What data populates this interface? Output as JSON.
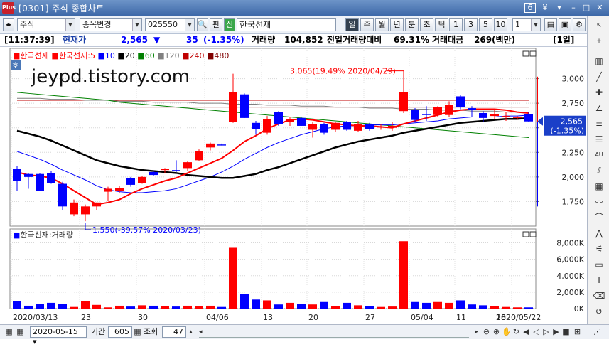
{
  "window": {
    "app_badge": "Plus",
    "title": "[0301] 주식 종합차트",
    "page_no": "6",
    "pin": "¥",
    "restore": "□",
    "close": "✕"
  },
  "toolbar": {
    "market": "주식",
    "mode": "종목변경",
    "code": "025550",
    "search_btn": "판",
    "new_badge": "신",
    "stock_name": "한국선재",
    "periods": [
      "일",
      "주",
      "월",
      "년",
      "분",
      "초",
      "틱"
    ],
    "selected_period": 0,
    "intervals": [
      "1",
      "3",
      "5",
      "10"
    ],
    "interval_value": "1"
  },
  "info": {
    "time": "[11:37:39]",
    "price_label": "현재가",
    "price": "2,565",
    "arrow": "▼",
    "change": "35",
    "change_pct": "(-1.35%)",
    "volume_label": "거래량",
    "volume": "104,852",
    "prev_vol_label": "전일거래량대비",
    "prev_vol": "69.31%",
    "amount_label": "거래대금",
    "amount": "269(백만)",
    "period_tag": "[1일]"
  },
  "colors": {
    "up": "#ff0000",
    "down": "#0000ff",
    "ma5": "#ff0000",
    "ma10": "#0000ff",
    "ma20": "#000000",
    "ma60": "#008000",
    "ma120": "#808080",
    "ma240": "#c00000",
    "ma480": "#800000"
  },
  "price_panel": {
    "legend": [
      {
        "text": "한국선재",
        "color": "#ff0000"
      },
      {
        "text": "한국선재:5",
        "color": "#ff0000"
      },
      {
        "text": "10",
        "color": "#0000ff"
      },
      {
        "text": "20",
        "color": "#000000"
      },
      {
        "text": "60",
        "color": "#008000"
      },
      {
        "text": "120",
        "color": "#808080"
      },
      {
        "text": "240",
        "color": "#c00000"
      },
      {
        "text": "480",
        "color": "#800000"
      }
    ],
    "quote_badge": "호",
    "watermark": "jeypd.tistory.com",
    "high_label": "3,065(19.49% 2020/04/29)",
    "low_label": "1,550(-39.57% 2020/03/23)",
    "price_tag": "2,565",
    "price_tag_pct": "(-1.35%)"
  },
  "volume_panel": {
    "legend": "한국선재:거래량"
  },
  "chart_data": [
    {
      "type": "candlestick",
      "ylim": [
        1500,
        3250
      ],
      "y_ticks": [
        1750,
        2000,
        2250,
        2500,
        2750,
        3000
      ],
      "y_tick_labels": [
        "1,750",
        "2,000",
        "2,250",
        "2,500",
        "2,750",
        "3,000"
      ],
      "candles": [
        {
          "o": 2080,
          "h": 2110,
          "l": 1860,
          "c": 1960
        },
        {
          "o": 2030,
          "h": 2040,
          "l": 1880,
          "c": 2000
        },
        {
          "o": 2030,
          "h": 2040,
          "l": 1860,
          "c": 1860
        },
        {
          "o": 2040,
          "h": 2060,
          "l": 1930,
          "c": 1940
        },
        {
          "o": 1930,
          "h": 1950,
          "l": 1660,
          "c": 1700
        },
        {
          "o": 1620,
          "h": 1770,
          "l": 1600,
          "c": 1740
        },
        {
          "o": 1620,
          "h": 1720,
          "l": 1550,
          "c": 1700
        },
        {
          "o": 1700,
          "h": 1740,
          "l": 1660,
          "c": 1740
        },
        {
          "o": 1850,
          "h": 1900,
          "l": 1760,
          "c": 1880
        },
        {
          "o": 1860,
          "h": 1910,
          "l": 1840,
          "c": 1890
        },
        {
          "o": 1990,
          "h": 2000,
          "l": 1900,
          "c": 1920
        },
        {
          "o": 1940,
          "h": 2010,
          "l": 1930,
          "c": 2000
        },
        {
          "o": 2050,
          "h": 2060,
          "l": 2010,
          "c": 2020
        },
        {
          "o": 2070,
          "h": 2090,
          "l": 2040,
          "c": 2080
        },
        {
          "o": 2070,
          "h": 2170,
          "l": 2050,
          "c": 2060
        },
        {
          "o": 2090,
          "h": 2160,
          "l": 2060,
          "c": 2150
        },
        {
          "o": 2170,
          "h": 2280,
          "l": 2160,
          "c": 2260
        },
        {
          "o": 2300,
          "h": 2350,
          "l": 2270,
          "c": 2340
        },
        {
          "o": 2330,
          "h": 2340,
          "l": 2320,
          "c": 2320
        },
        {
          "o": 2560,
          "h": 3050,
          "l": 2550,
          "c": 2860
        },
        {
          "o": 2840,
          "h": 2850,
          "l": 2600,
          "c": 2600
        },
        {
          "o": 2550,
          "h": 2570,
          "l": 2430,
          "c": 2490
        },
        {
          "o": 2450,
          "h": 2620,
          "l": 2430,
          "c": 2590
        },
        {
          "o": 2660,
          "h": 2670,
          "l": 2520,
          "c": 2540
        },
        {
          "o": 2560,
          "h": 2610,
          "l": 2520,
          "c": 2590
        },
        {
          "o": 2600,
          "h": 2610,
          "l": 2520,
          "c": 2520
        },
        {
          "o": 2480,
          "h": 2560,
          "l": 2400,
          "c": 2540
        },
        {
          "o": 2540,
          "h": 2550,
          "l": 2430,
          "c": 2450
        },
        {
          "o": 2480,
          "h": 2560,
          "l": 2460,
          "c": 2550
        },
        {
          "o": 2560,
          "h": 2570,
          "l": 2470,
          "c": 2480
        },
        {
          "o": 2470,
          "h": 2570,
          "l": 2460,
          "c": 2540
        },
        {
          "o": 2540,
          "h": 2550,
          "l": 2470,
          "c": 2490
        },
        {
          "o": 2510,
          "h": 2540,
          "l": 2480,
          "c": 2510
        },
        {
          "o": 2500,
          "h": 2560,
          "l": 2470,
          "c": 2520
        },
        {
          "o": 2670,
          "h": 3065,
          "l": 2650,
          "c": 2860
        },
        {
          "o": 2680,
          "h": 2700,
          "l": 2560,
          "c": 2580
        },
        {
          "o": 2640,
          "h": 2720,
          "l": 2570,
          "c": 2630
        },
        {
          "o": 2630,
          "h": 2720,
          "l": 2610,
          "c": 2710
        },
        {
          "o": 2630,
          "h": 2770,
          "l": 2610,
          "c": 2730
        },
        {
          "o": 2820,
          "h": 2830,
          "l": 2690,
          "c": 2710
        },
        {
          "o": 2700,
          "h": 2720,
          "l": 2610,
          "c": 2680
        },
        {
          "o": 2650,
          "h": 2670,
          "l": 2560,
          "c": 2600
        },
        {
          "o": 2620,
          "h": 2680,
          "l": 2590,
          "c": 2640
        },
        {
          "o": 2610,
          "h": 2660,
          "l": 2570,
          "c": 2620
        },
        {
          "o": 2600,
          "h": 2620,
          "l": 2580,
          "c": 2610
        },
        {
          "o": 2640,
          "h": 2660,
          "l": 2560,
          "c": 2565
        }
      ],
      "ma5": [
        2050,
        2020,
        2010,
        1990,
        1930,
        1860,
        1790,
        1720,
        1740,
        1770,
        1830,
        1880,
        1920,
        1960,
        1990,
        2040,
        2090,
        2140,
        2190,
        2270,
        2360,
        2420,
        2490,
        2540,
        2580,
        2590,
        2580,
        2560,
        2540,
        2530,
        2520,
        2520,
        2510,
        2500,
        2540,
        2570,
        2600,
        2630,
        2660,
        2680,
        2690,
        2690,
        2690,
        2680,
        2660,
        2650
      ],
      "ma10": [
        2260,
        2220,
        2180,
        2130,
        2070,
        2020,
        1970,
        1910,
        1870,
        1850,
        1840,
        1840,
        1850,
        1860,
        1880,
        1920,
        1960,
        2000,
        2050,
        2110,
        2180,
        2240,
        2300,
        2350,
        2390,
        2430,
        2460,
        2490,
        2510,
        2520,
        2520,
        2530,
        2530,
        2530,
        2540,
        2550,
        2560,
        2570,
        2590,
        2600,
        2610,
        2610,
        2610,
        2620,
        2620,
        2630
      ],
      "ma20": [
        2470,
        2440,
        2410,
        2370,
        2320,
        2270,
        2220,
        2170,
        2140,
        2110,
        2090,
        2070,
        2060,
        2050,
        2040,
        2020,
        2010,
        2000,
        1990,
        1990,
        2010,
        2030,
        2070,
        2100,
        2140,
        2180,
        2220,
        2260,
        2300,
        2330,
        2360,
        2380,
        2400,
        2420,
        2450,
        2470,
        2490,
        2510,
        2530,
        2550,
        2560,
        2570,
        2580,
        2590,
        2590,
        2600
      ],
      "ma60": [
        2860,
        2850,
        2840,
        2830,
        2820,
        2810,
        2800,
        2790,
        2780,
        2760,
        2750,
        2740,
        2730,
        2720,
        2710,
        2700,
        2690,
        2680,
        2670,
        2660,
        2650,
        2640,
        2630,
        2620,
        2610,
        2600,
        2590,
        2580,
        2570,
        2560,
        2550,
        2540,
        2530,
        2520,
        2510,
        2500,
        2490,
        2480,
        2470,
        2460,
        2450,
        2440,
        2430,
        2420,
        2410,
        2400
      ],
      "ma120": [
        2800,
        2800,
        2800,
        2790,
        2790,
        2790,
        2780,
        2780,
        2780,
        2770,
        2770,
        2770,
        2760,
        2760,
        2760,
        2760,
        2750,
        2750,
        2750,
        2740,
        2740,
        2740,
        2730,
        2730,
        2730,
        2720,
        2720,
        2720,
        2710,
        2710,
        2710,
        2700,
        2700,
        2700,
        2690,
        2690,
        2690,
        2680,
        2680,
        2680,
        2670,
        2670,
        2670,
        2660,
        2660,
        2660
      ],
      "ma240": [
        2780,
        2780,
        2780,
        2780,
        2780,
        2780,
        2780,
        2780,
        2780,
        2780,
        2780,
        2780,
        2780,
        2780,
        2780,
        2780,
        2780,
        2780,
        2780,
        2780,
        2780,
        2780,
        2780,
        2780,
        2780,
        2780,
        2780,
        2780,
        2780,
        2780,
        2780,
        2780,
        2780,
        2780,
        2780,
        2780,
        2780,
        2780,
        2780,
        2780,
        2780,
        2780,
        2780,
        2780,
        2780,
        2780
      ],
      "ma480": [
        2710,
        2710,
        2710,
        2710,
        2710,
        2710,
        2710,
        2710,
        2710,
        2710,
        2710,
        2710,
        2710,
        2710,
        2710,
        2710,
        2710,
        2710,
        2710,
        2710,
        2710,
        2710,
        2710,
        2710,
        2710,
        2710,
        2710,
        2710,
        2710,
        2710,
        2710,
        2710,
        2710,
        2710,
        2710,
        2710,
        2710,
        2710,
        2710,
        2710,
        2710,
        2710,
        2710,
        2710,
        2710,
        2710
      ]
    },
    {
      "type": "bar",
      "ylim": [
        0,
        9000
      ],
      "y_ticks": [
        0,
        2000,
        4000,
        6000,
        8000
      ],
      "y_tick_labels": [
        "0K",
        "2,000K",
        "4,000K",
        "6,000K",
        "8,000K"
      ],
      "values": [
        900,
        350,
        600,
        700,
        550,
        200,
        900,
        450,
        150,
        350,
        250,
        400,
        350,
        300,
        250,
        350,
        300,
        350,
        200,
        7400,
        1800,
        1100,
        1000,
        500,
        700,
        600,
        500,
        800,
        300,
        700,
        400,
        300,
        200,
        250,
        8200,
        800,
        700,
        800,
        700,
        1000,
        500,
        400,
        300,
        200,
        150,
        150
      ],
      "x_tick_labels": [
        {
          "i": 0,
          "t": "2020/03/13"
        },
        {
          "i": 6,
          "t": "23"
        },
        {
          "i": 11,
          "t": "30"
        },
        {
          "i": 17,
          "t": "04/06"
        },
        {
          "i": 22,
          "t": "13"
        },
        {
          "i": 26,
          "t": "20"
        },
        {
          "i": 31,
          "t": "27"
        },
        {
          "i": 35,
          "t": "05/04"
        },
        {
          "i": 39,
          "t": "11"
        },
        {
          "i": 44,
          "t": "18"
        },
        {
          "i": 49,
          "t": "2020/05/22"
        }
      ]
    }
  ],
  "bottom": {
    "date": "2020-05-15",
    "period_label": "기간",
    "period_value": "605",
    "view_label": "조회",
    "view_value": "47"
  }
}
